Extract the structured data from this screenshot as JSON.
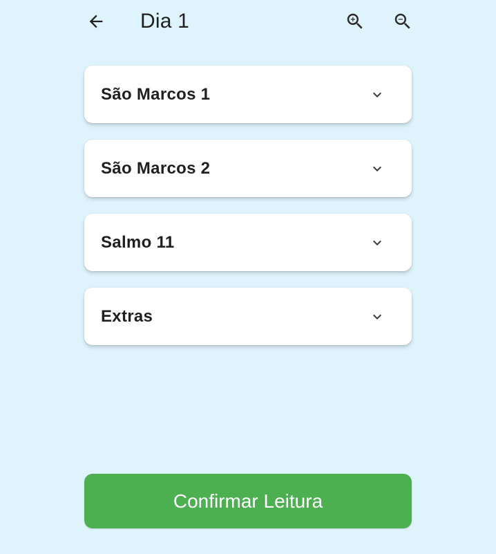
{
  "app_bar": {
    "title": "Dia 1",
    "back_icon": "arrow-left-icon",
    "zoom_in_icon": "zoom-in-icon",
    "zoom_out_icon": "zoom-out-icon"
  },
  "sections": [
    {
      "label": "São Marcos 1",
      "icon": "chevron-down-icon"
    },
    {
      "label": "São Marcos 2",
      "icon": "chevron-down-icon"
    },
    {
      "label": "Salmo 11",
      "icon": "chevron-down-icon"
    },
    {
      "label": "Extras",
      "icon": "chevron-down-icon"
    }
  ],
  "confirm_button": {
    "label": "Confirmar Leitura"
  },
  "colors": {
    "background": "#DFF3FD",
    "card": "#FFFFFF",
    "confirm": "#4CB050",
    "text": "#1F1F1F"
  }
}
